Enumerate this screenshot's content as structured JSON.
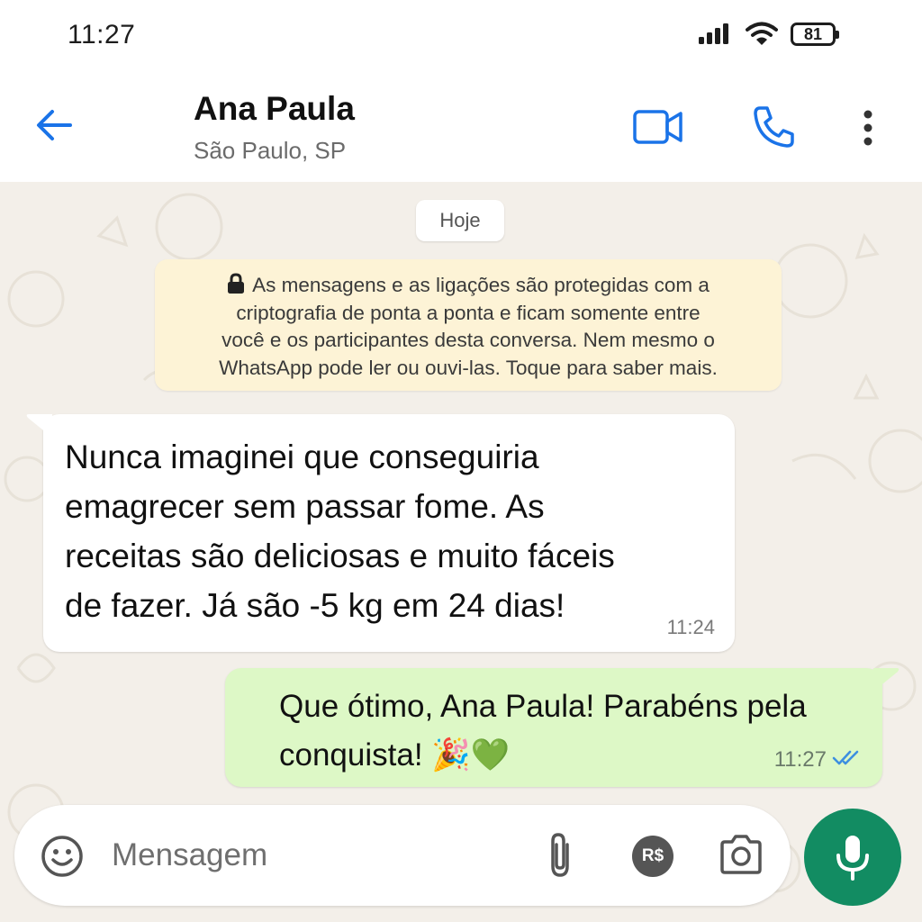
{
  "status_bar": {
    "time": "11:27",
    "battery": "81",
    "icons": [
      "signal-icon",
      "wifi-icon",
      "battery-icon"
    ]
  },
  "header": {
    "contact_name": "Ana Paula",
    "contact_subtitle": "São Paulo, SP",
    "icons": [
      "back-arrow-icon",
      "video-call-icon",
      "phone-icon",
      "more-options-icon"
    ]
  },
  "chat": {
    "date_chip": "Hoje",
    "encryption_notice": {
      "lines": [
        "As mensagens e as ligações são protegidas com a",
        "criptografia de ponta a ponta e ficam somente entre",
        "você e os participantes desta conversa. Nem mesmo o",
        "WhatsApp pode ler ou ouvi-las. Toque para saber mais."
      ]
    },
    "messages": [
      {
        "direction": "incoming",
        "lines": [
          "Nunca imaginei que conseguiria",
          "emagrecer sem passar fome. As",
          "receitas são deliciosas e muito fáceis",
          "de fazer. Já são -5 kg em 24 dias!"
        ],
        "time": "11:24"
      },
      {
        "direction": "outgoing",
        "lines": [
          "Que ótimo, Ana Paula! Parabéns pela",
          "conquista! 🎉💚"
        ],
        "time": "11:27",
        "status": "read"
      }
    ]
  },
  "composer": {
    "placeholder": "Mensagem",
    "icons": [
      "emoji-icon",
      "attach-icon",
      "payment-icon",
      "camera-icon",
      "mic-icon"
    ],
    "payment_label": "R$"
  },
  "colors": {
    "accent_blue": "#1a73e8",
    "incoming_bubble": "#ffffff",
    "outgoing_bubble": "#ddf8c6",
    "encryption_bg": "#fdf3d6",
    "mic_button": "#128c62",
    "read_ticks": "#3d8fe0"
  }
}
